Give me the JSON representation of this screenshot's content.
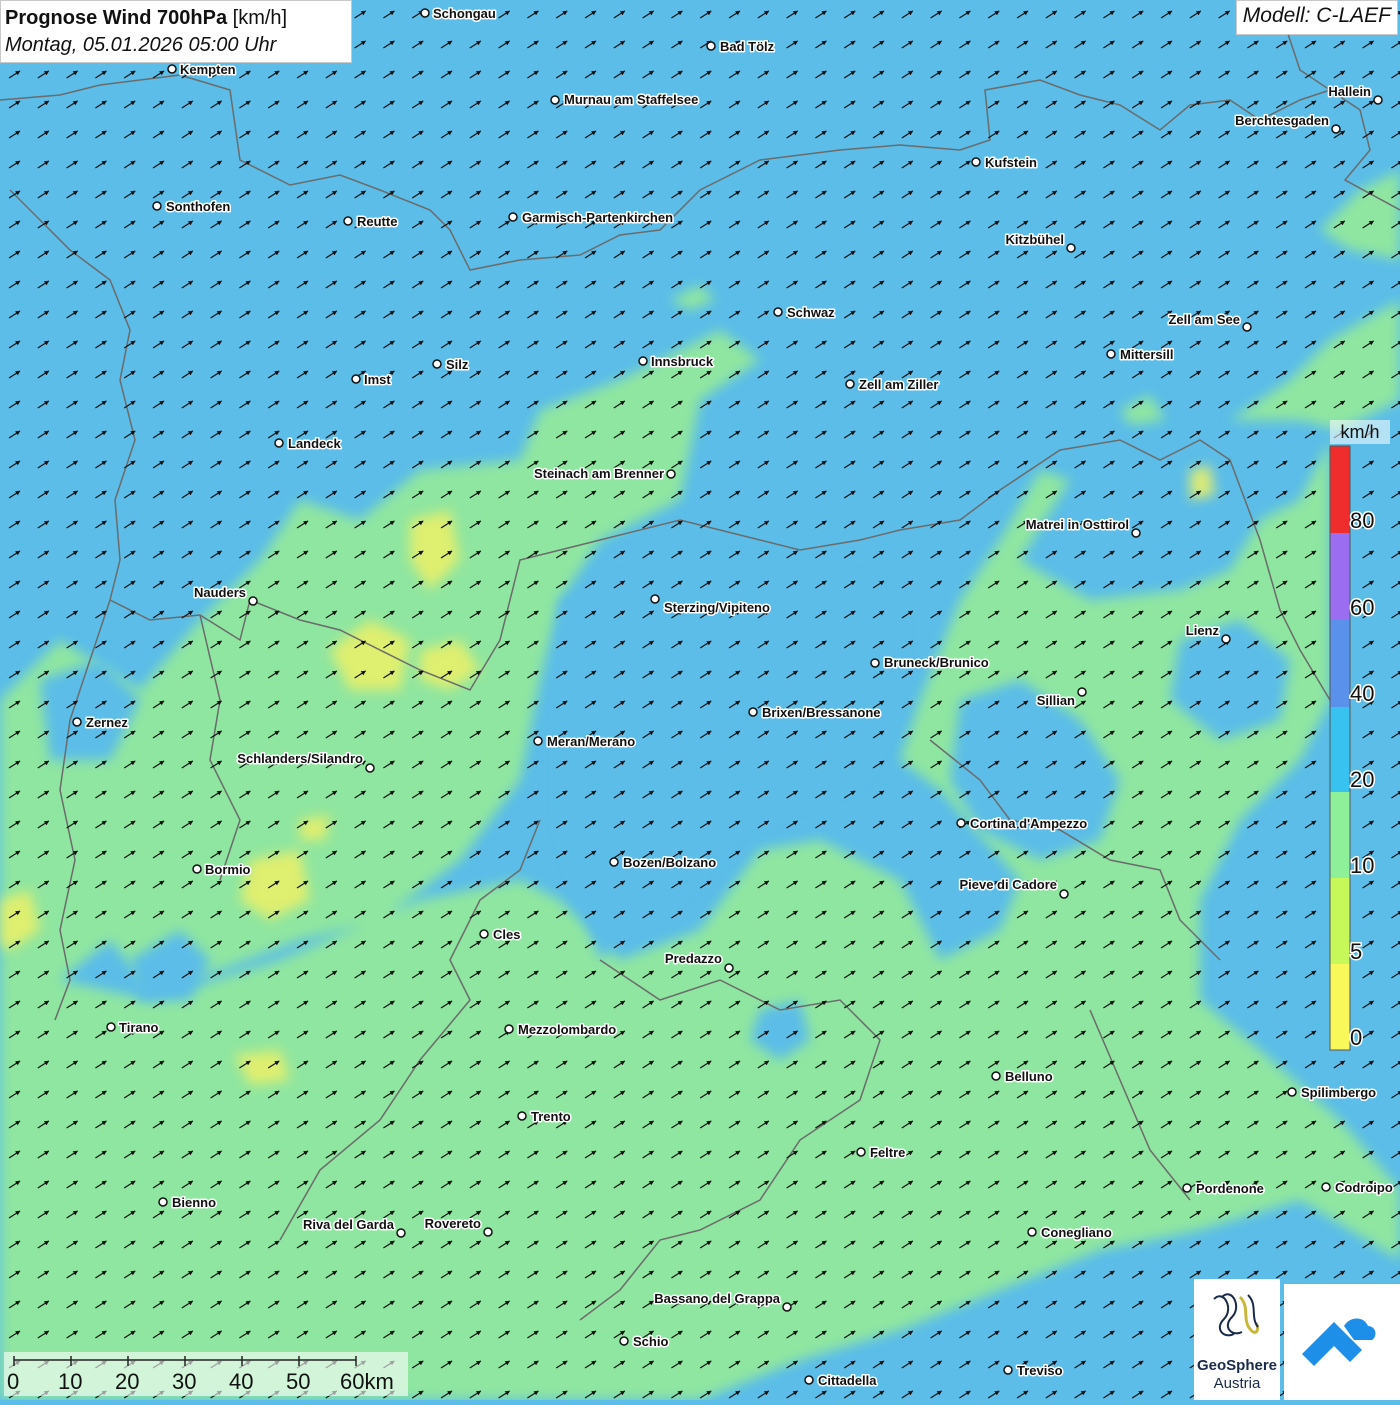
{
  "header": {
    "title_bold": "Prognose Wind 700hPa",
    "title_unit": "[km/h]",
    "subtitle": "Montag, 05.01.2026 05:00 Uhr"
  },
  "model": {
    "label": "Modell: C-LAEF"
  },
  "legend": {
    "unit": "km/h",
    "tick_labels": [
      "80",
      "60",
      "40",
      "20",
      "10",
      "5",
      "0"
    ],
    "colors": [
      "#ffffff",
      "#ef2d2d",
      "#9b6df0",
      "#5a91ea",
      "#37c2f0",
      "#8ff09a",
      "#c6f85a",
      "#f8f85a"
    ]
  },
  "colors": {
    "blue_band": "#5bbde8",
    "green_band": "#8fe6a0",
    "yellow_band": "#e8f06a",
    "border_line": "#6b6b6b",
    "arrow": "#111111"
  },
  "cities": [
    "Schongau",
    "Bad Tölz",
    "Kempten",
    "Murnau am Staffelsee",
    "Hallein",
    "Berchtesgaden",
    "Kufstein",
    "Sonthofen",
    "Reutte",
    "Garmisch-Partenkirchen",
    "Kitzbühel",
    "Schwaz",
    "Zell am See",
    "Innsbruck",
    "Mittersill",
    "Silz",
    "Imst",
    "Zell am Ziller",
    "Landeck",
    "Steinach am Brenner",
    "Matrei in Osttirol",
    "Nauders",
    "Sterzing/Vipiteno",
    "Lienz",
    "Bruneck/Brunico",
    "Sillian",
    "Zernez",
    "Brixen/Bressanone",
    "Meran/Merano",
    "Schlanders/Silandro",
    "Cortina d'Ampezzo",
    "Bozen/Bolzano",
    "Bormio",
    "Pieve di Cadore",
    "Cles",
    "Predazzo",
    "Tirano",
    "Mezzolombardo",
    "Belluno",
    "Spilimbergo",
    "Trento",
    "Feltre",
    "Pordenone",
    "Codroipo",
    "Bienno",
    "Riva del Garda",
    "Rovereto",
    "Conegliano",
    "Bassano del Grappa",
    "Schio",
    "Treviso",
    "Cittadella"
  ],
  "scalebar": {
    "labels": [
      "0",
      "10",
      "20",
      "30",
      "40",
      "50",
      "60km"
    ]
  },
  "logos": {
    "geosphere_line1": "GeoSphere",
    "geosphere_line2": "Austria"
  }
}
